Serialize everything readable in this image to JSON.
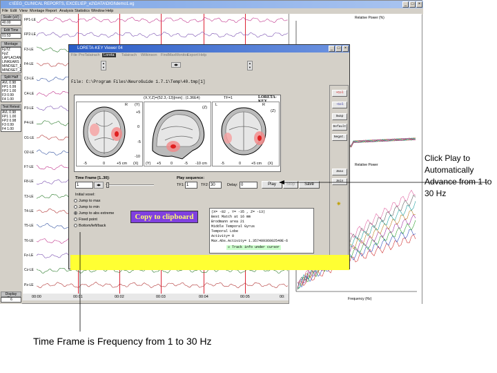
{
  "main_window": {
    "title": "c:\\EEG_CLINICAL REPORTS, EXCEL\\EP_e2\\DATA\\DIGI\\demo1.eg",
    "menu": [
      "File",
      "Edit",
      "View",
      "Montage",
      "Report",
      "Analysis",
      "Statistics",
      "Window",
      "Help"
    ]
  },
  "left_panel": {
    "scale_label": "Scale (uV)",
    "scale_value": "40.00",
    "epoch_label": "Edit Time",
    "epoch_value": "01:53",
    "montage_label": "Montage",
    "montage_items": [
      "FpTZ",
      "FpZ",
      "LAPLACIAN",
      "LINKEARS",
      "MINDSET_1",
      "MINDSET_2"
    ],
    "split_half_label": "Split Half",
    "split_half_items": [
      "AVL 0.98",
      "FP1 0.99",
      "FP2 1.00",
      "F3 0.99",
      "F4 1.00"
    ],
    "test_retest_label": "Test Retest",
    "test_retest_items": [
      "AVL 0.98",
      "FP1 1.00",
      "FP2 0.98",
      "F3 0.99",
      "F4 1.00"
    ],
    "display_time_label": "Display Time",
    "display_time_value": "6"
  },
  "channels": [
    "FP1-LE",
    "FP2-LE",
    "F3-LE",
    "F4-LE",
    "C3-LE",
    "C4-LE",
    "P3-LE",
    "P4-LE",
    "O1-LE",
    "O2-LE",
    "F7-LE",
    "F8-LE",
    "T3-LE",
    "T4-LE",
    "T5-LE",
    "T6-LE",
    "Fz-LE",
    "Cz-LE",
    "Pz-LE"
  ],
  "timeline": [
    "00:00",
    "00:01",
    "00:02",
    "00:03",
    "00:04",
    "00:05",
    "00:"
  ],
  "plots": {
    "top_ylabel": "Relative Power (%)",
    "bottom_ylabel": "Relative Power",
    "bottom_xlabel": "Frequency (Hz)"
  },
  "loreta": {
    "title": "LORETA-KEY Viewer 04",
    "menu": [
      "File",
      "ProTalairach",
      "Loreta",
      "Talairach",
      "Wilkinson",
      "FindMaxMonitor",
      "Export",
      "Help"
    ],
    "file_path": "File: C:\\Program Files\\NeuroGuide 1.7.1\\Temp\\40.tmp[1]",
    "coords_header": "(X,Y,Z)=(52.3,-13)[mm] ; (1.36E4)",
    "tf_label": "TF=1",
    "brand": "LORETA-KEY",
    "axial": {
      "r": "R",
      "y": "(Y)",
      "ticks": [
        "-5",
        "0",
        "+5 cm",
        "(X)"
      ],
      "side": [
        "+5",
        "0",
        "-5",
        "-10"
      ]
    },
    "sagittal": {
      "ticks": [
        "(Y)",
        "+5",
        "0",
        "-5",
        "-10 cm"
      ],
      "z": "(Z)"
    },
    "coronal": {
      "l": "L",
      "r": "R",
      "z": "(Z)",
      "ticks": [
        "-5",
        "0",
        "+5 cm",
        "(X)"
      ]
    },
    "tools": [
      "+Col",
      "-Col",
      "Swap",
      "Default",
      "Negat.",
      "Jmax",
      "Jmin"
    ],
    "time_frame_label": "Time Frame [1..30]:",
    "time_frame_value": "1",
    "play_seq_label": "Play sequence:",
    "tf1_label": "TF1:",
    "tf1_value": "1",
    "tf2_label": "TF2:",
    "tf2_value": "30",
    "delay_label": "Delay:",
    "delay_value": "0",
    "play": "Play",
    "stop": "Stop",
    "save": "Save",
    "initial_voxel_label": "Initial voxel:",
    "voxel_options": [
      "Jump to max",
      "Jump to min",
      "Jump to abs extreme",
      "Fixed point",
      "Bottom/left/back"
    ],
    "copy_btn": "Copy to clipboard",
    "info_lines": [
      "(X= -82 , Y= -35 , Z= -13)",
      "Best Match at 16 mm",
      "Brodmann area 21",
      "Middle Temporal Gyrus",
      "Temporal Lobe",
      "Activity= 0",
      "Max.Abs.Activity= 1.35740936002549E-6"
    ],
    "track_label": "Track info under cursor"
  },
  "annotations": {
    "right": "Click Play to Automatically Advance from 1 to 30 Hz",
    "bottom": "Time Frame is Frequency from 1 to 30 Hz"
  },
  "colors": {
    "title_blue": "#2a5cc6",
    "copy_purple": "#8040e0",
    "copy_text": "#ffff70",
    "yellow_bar": "#ffff33",
    "tool_red": "#cc0000"
  }
}
